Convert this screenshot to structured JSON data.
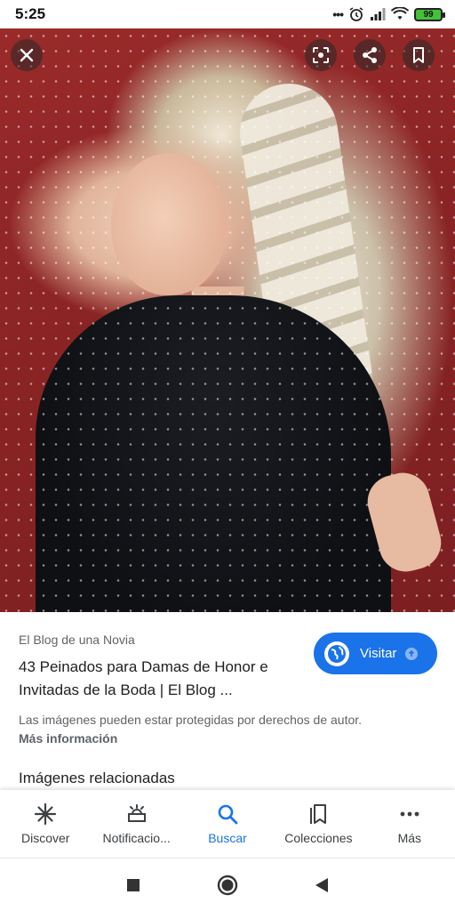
{
  "status_bar": {
    "time": "5:25",
    "battery": "99"
  },
  "image": {
    "description_icons": [
      "close-icon",
      "lens-icon",
      "share-icon",
      "bookmark-icon"
    ]
  },
  "result": {
    "source": "El Blog de una Novia",
    "title_line1": "43 Peinados para Damas de Honor e",
    "title_line2": "Invitadas de la Boda | El Blog ...",
    "visit_label": "Visitar",
    "copyright": "Las imágenes pueden estar protegidas por derechos de autor.",
    "more_info": "Más información",
    "related": "Imágenes relacionadas"
  },
  "bottom_nav": {
    "items": [
      {
        "label": "Discover",
        "icon": "discover-icon"
      },
      {
        "label": "Notificacio...",
        "icon": "notifications-icon"
      },
      {
        "label": "Buscar",
        "icon": "search-icon",
        "active": true
      },
      {
        "label": "Colecciones",
        "icon": "collections-icon"
      },
      {
        "label": "Más",
        "icon": "more-icon"
      }
    ]
  },
  "colors": {
    "accent": "#1a73e8",
    "text_primary": "#202124",
    "text_secondary": "#5f6368"
  }
}
